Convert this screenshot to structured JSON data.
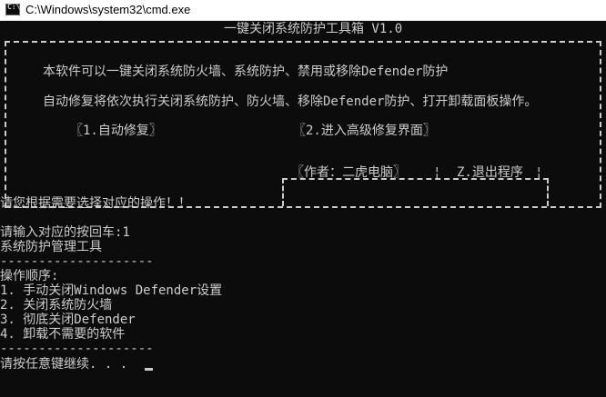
{
  "window": {
    "title": "C:\\Windows\\system32\\cmd.exe",
    "icon": "cmd-icon"
  },
  "banner": {
    "title": "一键关闭系统防护工具箱 V1.0",
    "line1": "本软件可以一键关闭系统防火墙、系统防护、禁用或移除Defender防护",
    "line2": "自动修复将依次执行关闭系统防护、防火墙、移除Defender防护、打开卸载面板操作。",
    "option1": "〖1.自动修复〗",
    "option2": "〖2.进入高级修复界面〗",
    "author": "〖作者：二虎电脑〗",
    "exit": "Z.退出程序"
  },
  "output": {
    "prompt_select": "请您根据需要选择对应的操作！！",
    "input_line": "请输入对应的按回车:1",
    "heading": "系统防护管理工具",
    "separator1": "--------------------",
    "steps_label": "操作顺序:",
    "steps": [
      "1. 手动关闭Windows Defender设置",
      "2. 关闭系统防火墙",
      "3. 彻底关闭Defender",
      "4. 卸载不需要的软件"
    ],
    "separator2": "--------------------",
    "continue_prompt": "请按任意键继续. . ."
  },
  "colors": {
    "console_bg": "#0c0c0c",
    "console_fg": "#cccccc",
    "titlebar_bg": "#ffffff"
  }
}
